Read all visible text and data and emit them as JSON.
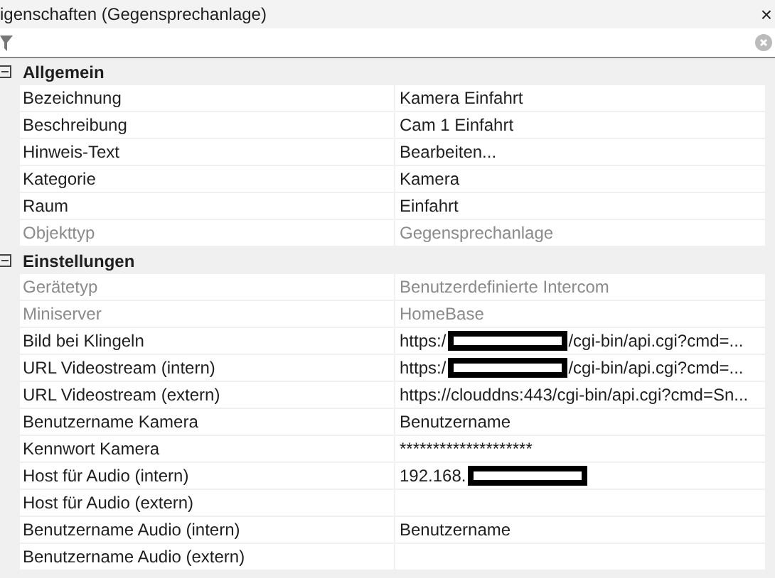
{
  "window": {
    "title": "igenschaften (Gegensprechanlage)",
    "close": "×"
  },
  "categories": [
    {
      "name": "Allgemein",
      "expanded": true,
      "rows": [
        {
          "name": "Bezeichnung",
          "value": "Kamera Einfahrt",
          "disabled": false
        },
        {
          "name": "Beschreibung",
          "value": "Cam 1 Einfahrt",
          "disabled": false
        },
        {
          "name": "Hinweis-Text",
          "value": "Bearbeiten...",
          "disabled": false
        },
        {
          "name": "Kategorie",
          "value": "Kamera",
          "disabled": false
        },
        {
          "name": "Raum",
          "value": "Einfahrt",
          "disabled": false
        },
        {
          "name": "Objekttyp",
          "value": "Gegensprechanlage",
          "disabled": true
        }
      ]
    },
    {
      "name": "Einstellungen",
      "expanded": true,
      "rows": [
        {
          "name": "Gerätetyp",
          "value": "Benutzerdefinierte Intercom",
          "disabled": true
        },
        {
          "name": "Miniserver",
          "value": "HomeBase",
          "disabled": true
        },
        {
          "name": "Bild bei Klingeln",
          "value": "https:/",
          "redacted": true,
          "value_after": "/cgi-bin/api.cgi?cmd=...",
          "disabled": false
        },
        {
          "name": "URL Videostream (intern)",
          "value": "https:/",
          "redacted": true,
          "value_after": "/cgi-bin/api.cgi?cmd=...",
          "disabled": false
        },
        {
          "name": "URL Videostream (extern)",
          "value": "https://clouddns:443/cgi-bin/api.cgi?cmd=Sn...",
          "disabled": false
        },
        {
          "name": "Benutzername Kamera",
          "value": "Benutzername",
          "disabled": false
        },
        {
          "name": "Kennwort Kamera",
          "value": "********************",
          "disabled": false
        },
        {
          "name": "Host für Audio (intern)",
          "value": "192.168.",
          "redacted": true,
          "disabled": false
        },
        {
          "name": "Host für Audio (extern)",
          "disabled": false
        },
        {
          "name": "Benutzername Audio (intern)",
          "value": "Benutzername",
          "disabled": false
        },
        {
          "name": "Benutzername Audio (extern)",
          "disabled": false
        }
      ]
    }
  ]
}
